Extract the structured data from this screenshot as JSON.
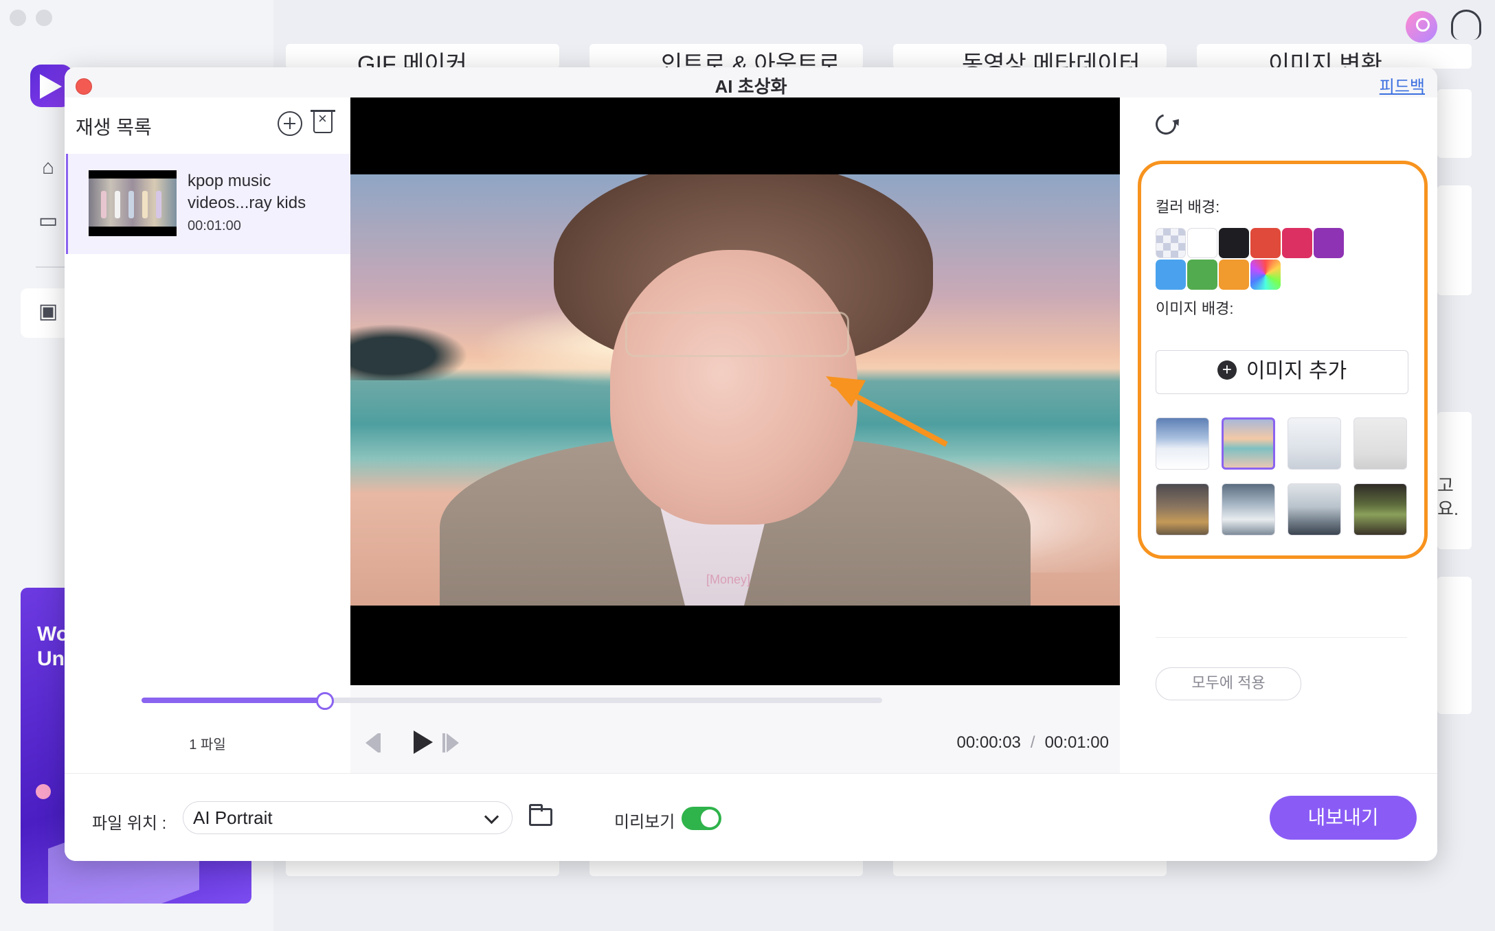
{
  "background_app": {
    "card_titles": [
      "GIF 메이커",
      "인트로 & 아웃트로",
      "동영상 메타데이터...",
      "이미지 변환"
    ],
    "promo_text": [
      "Wo",
      "Un"
    ],
    "side_text": [
      "고",
      "요."
    ]
  },
  "dialog": {
    "title": "AI 초상화",
    "feedback_label": "피드백"
  },
  "playlist": {
    "title": "재생 목록",
    "items": [
      {
        "name": "kpop music videos...ray kids",
        "duration": "00:01:00"
      }
    ],
    "count_label": "1 파일"
  },
  "player": {
    "current_time": "00:00:03",
    "separator": "/",
    "total_time": "00:01:00",
    "progress": 0.245,
    "subtitle_text": "[Money]"
  },
  "right_panel": {
    "color_bg_label": "컬러 배경:",
    "colors": [
      "transparent",
      "#ffffff",
      "#1d1d22",
      "#e04a3a",
      "#dc2f62",
      "#8e33b4",
      "#4aa2ee",
      "#52ab4f",
      "#f19a2e",
      "rainbow"
    ],
    "image_bg_label": "이미지 배경:",
    "add_image_label": "이미지 추가",
    "backgrounds": [
      {
        "name": "snow-mountain",
        "selected": false
      },
      {
        "name": "beach-sunset",
        "selected": true
      },
      {
        "name": "white-room",
        "selected": false
      },
      {
        "name": "wall-plant",
        "selected": false
      },
      {
        "name": "office-lobby",
        "selected": false
      },
      {
        "name": "meeting-room",
        "selected": false
      },
      {
        "name": "office-desk",
        "selected": false
      },
      {
        "name": "bookshelf",
        "selected": false
      }
    ],
    "apply_all_label": "모두에 적용"
  },
  "bottom_bar": {
    "file_location_label": "파일 위치 :",
    "file_location_value": "AI Portrait",
    "preview_label": "미리보기",
    "preview_on": true,
    "export_label": "내보내기"
  },
  "accent": {
    "purple": "#8a5cf5",
    "annotation_orange": "#f7931e",
    "toggle_green": "#2fb34b"
  }
}
